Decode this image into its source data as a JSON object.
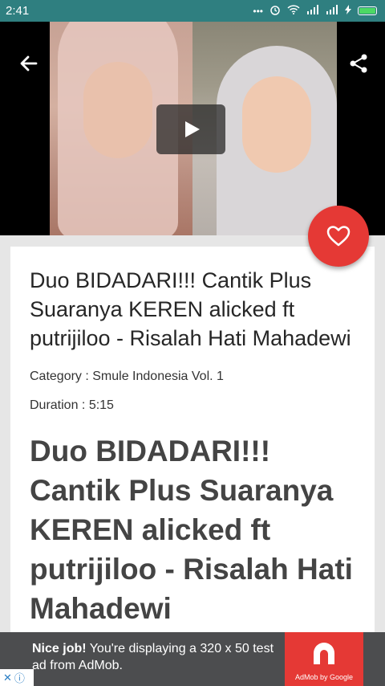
{
  "status_bar": {
    "time": "2:41",
    "icons": [
      "more-dots-icon",
      "alarm-icon",
      "wifi-icon",
      "signal-icon",
      "signal-icon",
      "charging-icon",
      "battery-icon"
    ]
  },
  "colors": {
    "status_bar": "#2f7f80",
    "fab": "#e53935",
    "ad_background": "#4c4d4f",
    "ad_logo": "#e53935"
  },
  "toolbar": {
    "back_icon": "arrow-left-icon",
    "share_icon": "share-icon"
  },
  "video": {
    "play_icon": "play-icon"
  },
  "favorite": {
    "icon": "heart-outline-icon"
  },
  "article": {
    "title": "Duo BIDADARI!!! Cantik Plus Suaranya KEREN alicked ft putrijiloo - Risalah Hati Mahadewi",
    "category": "Category : Smule Indonesia Vol. 1",
    "duration": "Duration : 5:15",
    "heading": "Duo BIDADARI!!! Cantik Plus Suaranya KEREN alicked ft putrijiloo - Risalah Hati Mahadewi"
  },
  "ad": {
    "headline": "Nice job!",
    "body": " You're displaying a 320 x 50 test ad from AdMob.",
    "brand": "AdMob by Google"
  }
}
